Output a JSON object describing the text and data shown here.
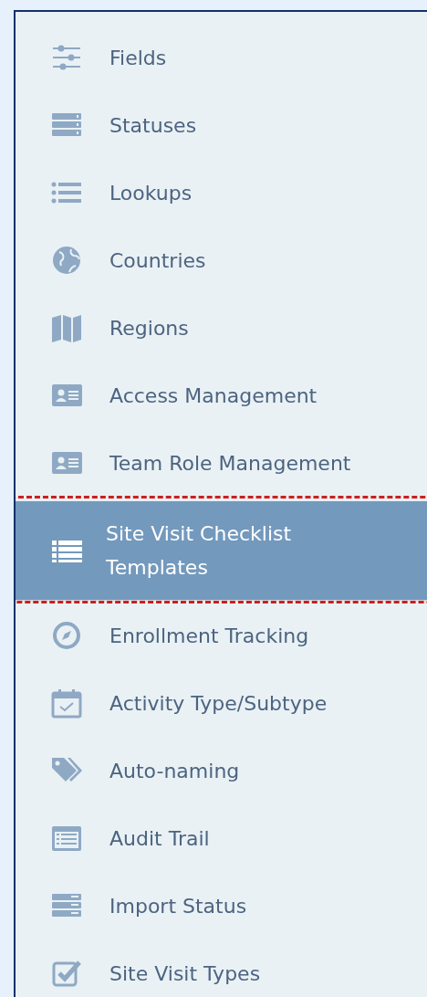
{
  "sidebar": {
    "items": [
      {
        "label": "Fields",
        "selected": false
      },
      {
        "label": "Statuses",
        "selected": false
      },
      {
        "label": "Lookups",
        "selected": false
      },
      {
        "label": "Countries",
        "selected": false
      },
      {
        "label": "Regions",
        "selected": false
      },
      {
        "label": "Access Management",
        "selected": false
      },
      {
        "label": "Team Role Management",
        "selected": false
      },
      {
        "label": "Site Visit Checklist Templates",
        "selected": true
      },
      {
        "label": "Enrollment Tracking",
        "selected": false
      },
      {
        "label": "Activity Type/Subtype",
        "selected": false
      },
      {
        "label": "Auto-naming",
        "selected": false
      },
      {
        "label": "Audit Trail",
        "selected": false
      },
      {
        "label": "Import Status",
        "selected": false
      },
      {
        "label": "Site Visit Types",
        "selected": false
      }
    ]
  }
}
